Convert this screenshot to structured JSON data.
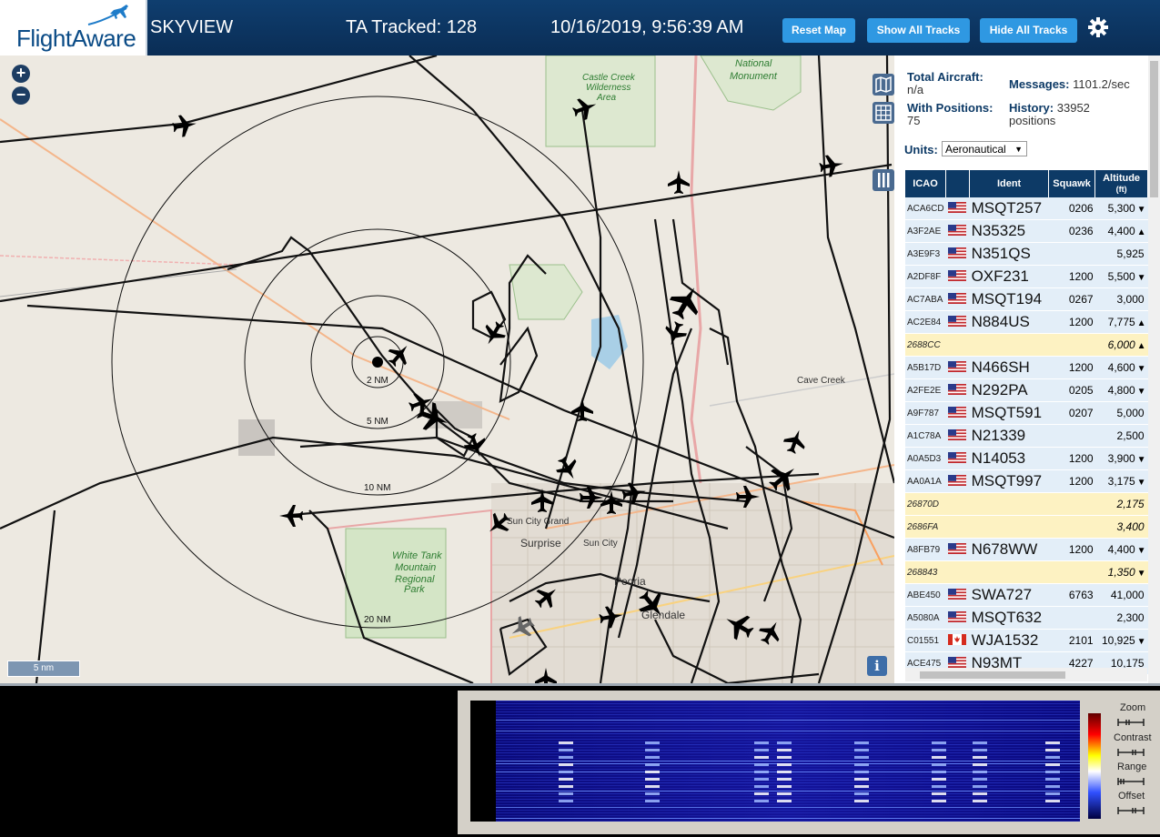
{
  "header": {
    "logo_text": "FlightAware",
    "app_title": "SKYVIEW",
    "ta_tracked": "TA Tracked: 128",
    "datetime": "10/16/2019, 9:56:39 AM",
    "buttons": {
      "reset_map": "Reset Map",
      "show_all_tracks": "Show All Tracks",
      "hide_all_tracks": "Hide All Tracks"
    }
  },
  "map": {
    "zoom_in": "+",
    "zoom_out": "−",
    "scale_label": "5 nm",
    "info_label": "i",
    "range_labels": [
      "2 NM",
      "5 NM",
      "10 NM",
      "20 NM"
    ],
    "place_labels": {
      "castle_creek": [
        "Castle Creek",
        "Wilderness",
        "Area"
      ],
      "national_monument": [
        "National",
        "Monument"
      ],
      "white_tank": [
        "White Tank",
        "Mountain",
        "Regional",
        "Park"
      ],
      "cave_creek": "Cave Creek",
      "sun_city_grand": "Sun City Grand",
      "surprise": "Surprise",
      "sun_city": "Sun City",
      "peoria": "Peoria",
      "glendale": "Glendale"
    }
  },
  "stats": {
    "total_aircraft_label": "Total Aircraft:",
    "total_aircraft_value": "n/a",
    "with_positions_label": "With Positions:",
    "with_positions_value": "75",
    "messages_label": "Messages:",
    "messages_value": "1101.2/sec",
    "history_label": "History:",
    "history_value": "33952",
    "history_unit": "positions",
    "units_label": "Units:",
    "units_value": "Aeronautical"
  },
  "table": {
    "headers": {
      "icao": "ICAO",
      "ident": "Ident",
      "squawk": "Squawk",
      "altitude": "Altitude",
      "altitude_unit": "(ft)"
    },
    "rows": [
      {
        "icao": "ACA6CD",
        "flag": "us",
        "ident": "MSQT257",
        "squawk": "0206",
        "altitude": "5,300",
        "trend": "▼",
        "type": "r"
      },
      {
        "icao": "A3F2AE",
        "flag": "us",
        "ident": "N35325",
        "squawk": "0236",
        "altitude": "4,400",
        "trend": "▲",
        "type": "r"
      },
      {
        "icao": "A3E9F3",
        "flag": "us",
        "ident": "N351QS",
        "squawk": "",
        "altitude": "5,925",
        "trend": "",
        "type": "r"
      },
      {
        "icao": "A2DF8F",
        "flag": "us",
        "ident": "OXF231",
        "squawk": "1200",
        "altitude": "5,500",
        "trend": "▼",
        "type": "r"
      },
      {
        "icao": "AC7ABA",
        "flag": "us",
        "ident": "MSQT194",
        "squawk": "0267",
        "altitude": "3,000",
        "trend": "",
        "type": "r"
      },
      {
        "icao": "AC2E84",
        "flag": "us",
        "ident": "N884US",
        "squawk": "1200",
        "altitude": "7,775",
        "trend": "▲",
        "type": "r"
      },
      {
        "icao": "2688CC",
        "flag": "",
        "ident": "",
        "squawk": "",
        "altitude": "6,000",
        "trend": "▲",
        "type": "y"
      },
      {
        "icao": "A5B17D",
        "flag": "us",
        "ident": "N466SH",
        "squawk": "1200",
        "altitude": "4,600",
        "trend": "▼",
        "type": "r"
      },
      {
        "icao": "A2FE2E",
        "flag": "us",
        "ident": "N292PA",
        "squawk": "0205",
        "altitude": "4,800",
        "trend": "▼",
        "type": "r"
      },
      {
        "icao": "A9F787",
        "flag": "us",
        "ident": "MSQT591",
        "squawk": "0207",
        "altitude": "5,000",
        "trend": "",
        "type": "r"
      },
      {
        "icao": "A1C78A",
        "flag": "us",
        "ident": "N21339",
        "squawk": "",
        "altitude": "2,500",
        "trend": "",
        "type": "r"
      },
      {
        "icao": "A0A5D3",
        "flag": "us",
        "ident": "N14053",
        "squawk": "1200",
        "altitude": "3,900",
        "trend": "▼",
        "type": "r"
      },
      {
        "icao": "AA0A1A",
        "flag": "us",
        "ident": "MSQT997",
        "squawk": "1200",
        "altitude": "3,175",
        "trend": "▼",
        "type": "r"
      },
      {
        "icao": "26870D",
        "flag": "",
        "ident": "",
        "squawk": "",
        "altitude": "2,175",
        "trend": "",
        "type": "y"
      },
      {
        "icao": "2686FA",
        "flag": "",
        "ident": "",
        "squawk": "",
        "altitude": "3,400",
        "trend": "",
        "type": "y"
      },
      {
        "icao": "A8FB79",
        "flag": "us",
        "ident": "N678WW",
        "squawk": "1200",
        "altitude": "4,400",
        "trend": "▼",
        "type": "r"
      },
      {
        "icao": "268843",
        "flag": "",
        "ident": "",
        "squawk": "",
        "altitude": "1,350",
        "trend": "▼",
        "type": "y"
      },
      {
        "icao": "ABE450",
        "flag": "us",
        "ident": "SWA727",
        "squawk": "6763",
        "altitude": "41,000",
        "trend": "",
        "type": "r"
      },
      {
        "icao": "A5080A",
        "flag": "us",
        "ident": "MSQT632",
        "squawk": "",
        "altitude": "2,300",
        "trend": "",
        "type": "r"
      },
      {
        "icao": "C01551",
        "flag": "ca",
        "ident": "WJA1532",
        "squawk": "2101",
        "altitude": "10,925",
        "trend": "▼",
        "type": "r"
      },
      {
        "icao": "ACE475",
        "flag": "us",
        "ident": "N93MT",
        "squawk": "4227",
        "altitude": "10,175",
        "trend": "",
        "type": "r"
      }
    ]
  },
  "waterfall": {
    "controls": [
      "Zoom",
      "Contrast",
      "Range",
      "Offset"
    ]
  },
  "colors": {
    "header_bg": "#0a2d55",
    "button": "#2f98e2",
    "table_header": "#0d3a66",
    "row_blue": "#e3eef8",
    "row_yellow": "#fdf2c2"
  }
}
